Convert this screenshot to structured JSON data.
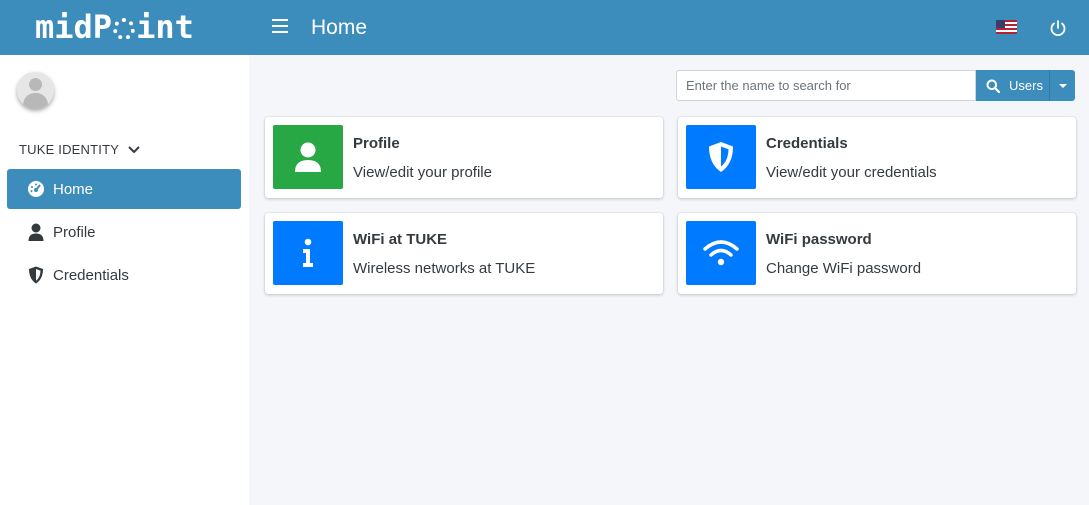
{
  "header": {
    "logo_text_start": "midP",
    "logo_text_end": "int",
    "title": "Home",
    "menu_icon": "hamburger-icon",
    "language_flag": "us-flag-icon",
    "logout_icon": "power-icon",
    "color": "#3c8dbc"
  },
  "sidebar": {
    "section_label": "TUKE IDENTITY",
    "items": [
      {
        "label": "Home",
        "icon": "dashboard-icon",
        "active": true
      },
      {
        "label": "Profile",
        "icon": "user-icon",
        "active": false
      },
      {
        "label": "Credentials",
        "icon": "shield-icon",
        "active": false
      }
    ]
  },
  "search": {
    "placeholder": "Enter the name to search for",
    "value": "",
    "type_label": "Users"
  },
  "cards": [
    {
      "title": "Profile",
      "description": "View/edit your profile",
      "icon": "user-icon",
      "color": "#28a745"
    },
    {
      "title": "Credentials",
      "description": "View/edit your credentials",
      "icon": "shield-icon",
      "color": "#007bff"
    },
    {
      "title": "WiFi at TUKE",
      "description": "Wireless networks at TUKE",
      "icon": "info-icon",
      "color": "#007bff"
    },
    {
      "title": "WiFi password",
      "description": "Change WiFi password",
      "icon": "wifi-icon",
      "color": "#007bff"
    }
  ]
}
